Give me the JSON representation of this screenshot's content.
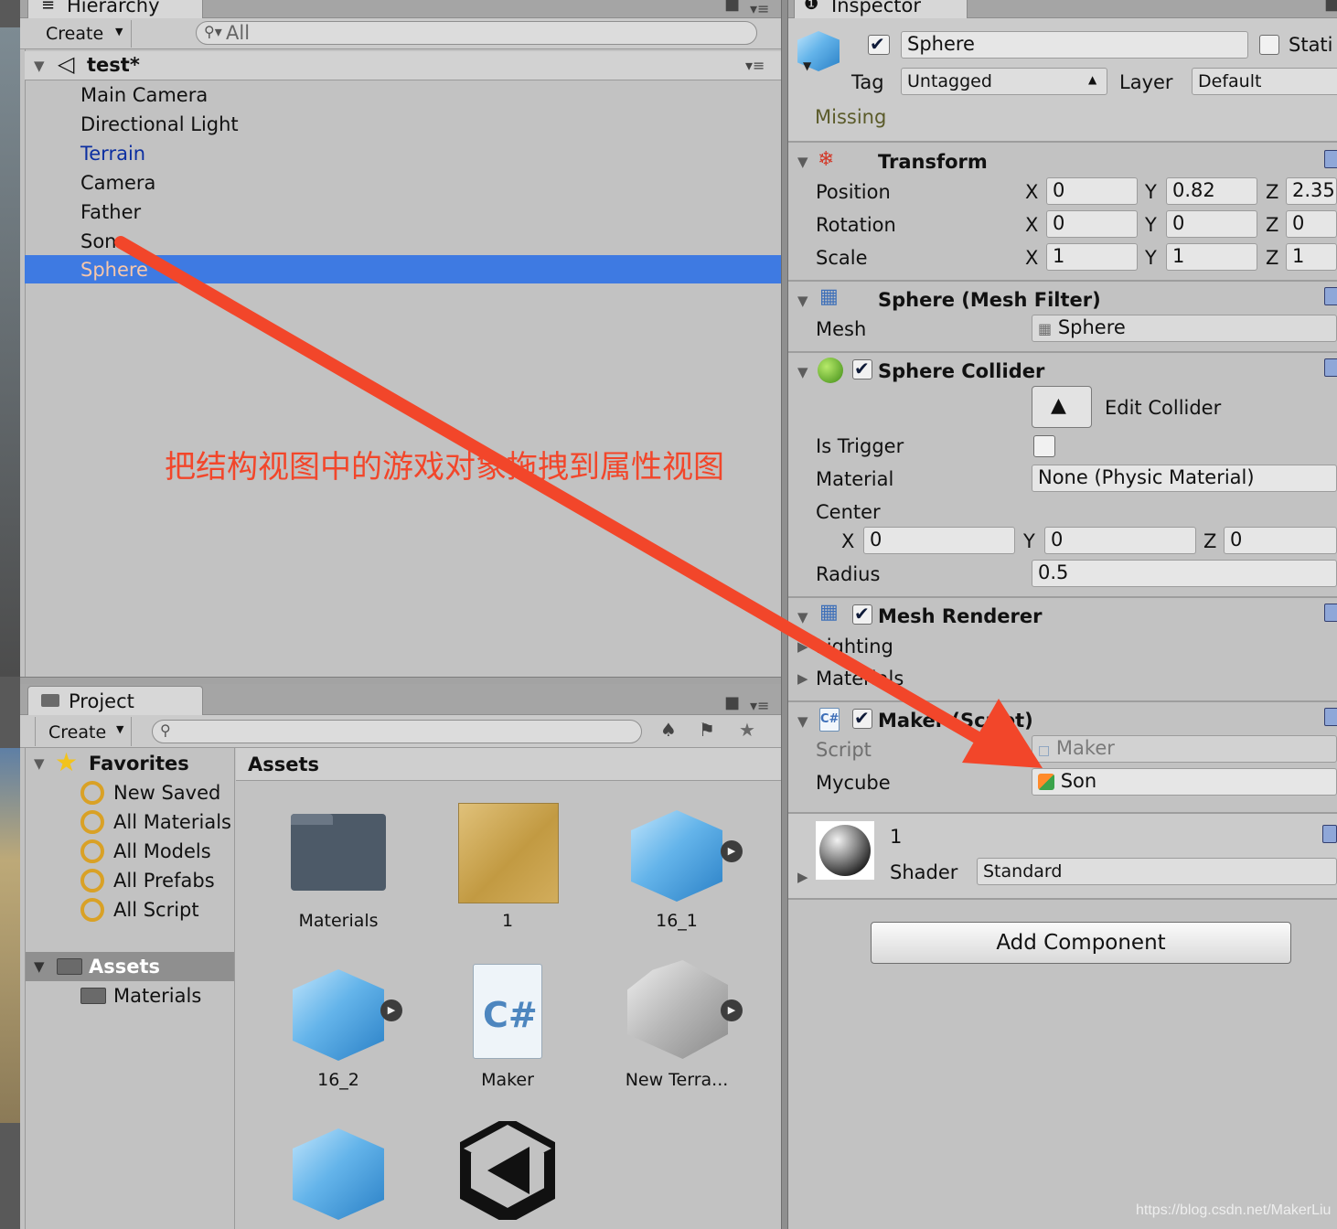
{
  "hierarchy": {
    "tab_label": "Hierarchy",
    "create_label": "Create",
    "search_placeholder": "All",
    "scene_name": "test*",
    "items": [
      {
        "label": "Main Camera",
        "state": "normal"
      },
      {
        "label": "Directional Light",
        "state": "normal"
      },
      {
        "label": "Terrain",
        "state": "prefab"
      },
      {
        "label": "Camera",
        "state": "normal"
      },
      {
        "label": "Father",
        "state": "normal"
      },
      {
        "label": "Son",
        "state": "normal"
      },
      {
        "label": "Sphere",
        "state": "selected"
      }
    ]
  },
  "annotation": {
    "text": "把结构视图中的游戏对象拖拽到属性视图",
    "color": "#f2462a"
  },
  "project": {
    "tab_label": "Project",
    "create_label": "Create",
    "favorites_label": "Favorites",
    "favorites": [
      "New Saved",
      "All Materials",
      "All Models",
      "All Prefabs",
      "All Script"
    ],
    "assets_label": "Assets",
    "asset_folders": [
      "Materials"
    ],
    "breadcrumb": "Assets",
    "grid": [
      {
        "label": "Materials",
        "icon": "folder-icon"
      },
      {
        "label": "1",
        "icon": "material-sand-icon"
      },
      {
        "label": "16_1",
        "icon": "cube-prefab-icon"
      },
      {
        "label": "16_2",
        "icon": "cube-prefab-icon"
      },
      {
        "label": "Maker",
        "icon": "csharp-script-icon"
      },
      {
        "label": "New Terra...",
        "icon": "terrain-icon"
      },
      {
        "label": "",
        "icon": "cube-prefab-icon"
      },
      {
        "label": "",
        "icon": "unity-scene-icon"
      }
    ]
  },
  "inspector": {
    "tab_label": "Inspector",
    "object_name": "Sphere",
    "static_label": "Stati",
    "tag_label": "Tag",
    "tag_value": "Untagged",
    "layer_label": "Layer",
    "layer_value": "Default",
    "missing_text": "Missing",
    "transform": {
      "title": "Transform",
      "rows": [
        {
          "label": "Position",
          "x": "0",
          "y": "0.82",
          "z": "2.35"
        },
        {
          "label": "Rotation",
          "x": "0",
          "y": "0",
          "z": "0"
        },
        {
          "label": "Scale",
          "x": "1",
          "y": "1",
          "z": "1"
        }
      ]
    },
    "mesh_filter": {
      "title": "Sphere (Mesh Filter)",
      "mesh_label": "Mesh",
      "mesh_value": "Sphere"
    },
    "sphere_collider": {
      "title": "Sphere Collider",
      "edit_label": "Edit Collider",
      "is_trigger_label": "Is Trigger",
      "material_label": "Material",
      "material_value": "None (Physic Material)",
      "center_label": "Center",
      "center": {
        "x": "0",
        "y": "0",
        "z": "0"
      },
      "radius_label": "Radius",
      "radius_value": "0.5"
    },
    "mesh_renderer": {
      "title": "Mesh Renderer",
      "lighting_label": "Lighting",
      "materials_label": "Materials"
    },
    "maker_script": {
      "title": "Maker (Script)",
      "script_label": "Script",
      "script_value": "Maker",
      "mycube_label": "Mycube",
      "mycube_value": "Son"
    },
    "material": {
      "name": "1",
      "shader_label": "Shader",
      "shader_value": "Standard"
    },
    "add_component_label": "Add Component"
  },
  "axis_labels": {
    "x": "X",
    "y": "Y",
    "z": "Z"
  },
  "watermark": "https://blog.csdn.net/MakerLiu"
}
